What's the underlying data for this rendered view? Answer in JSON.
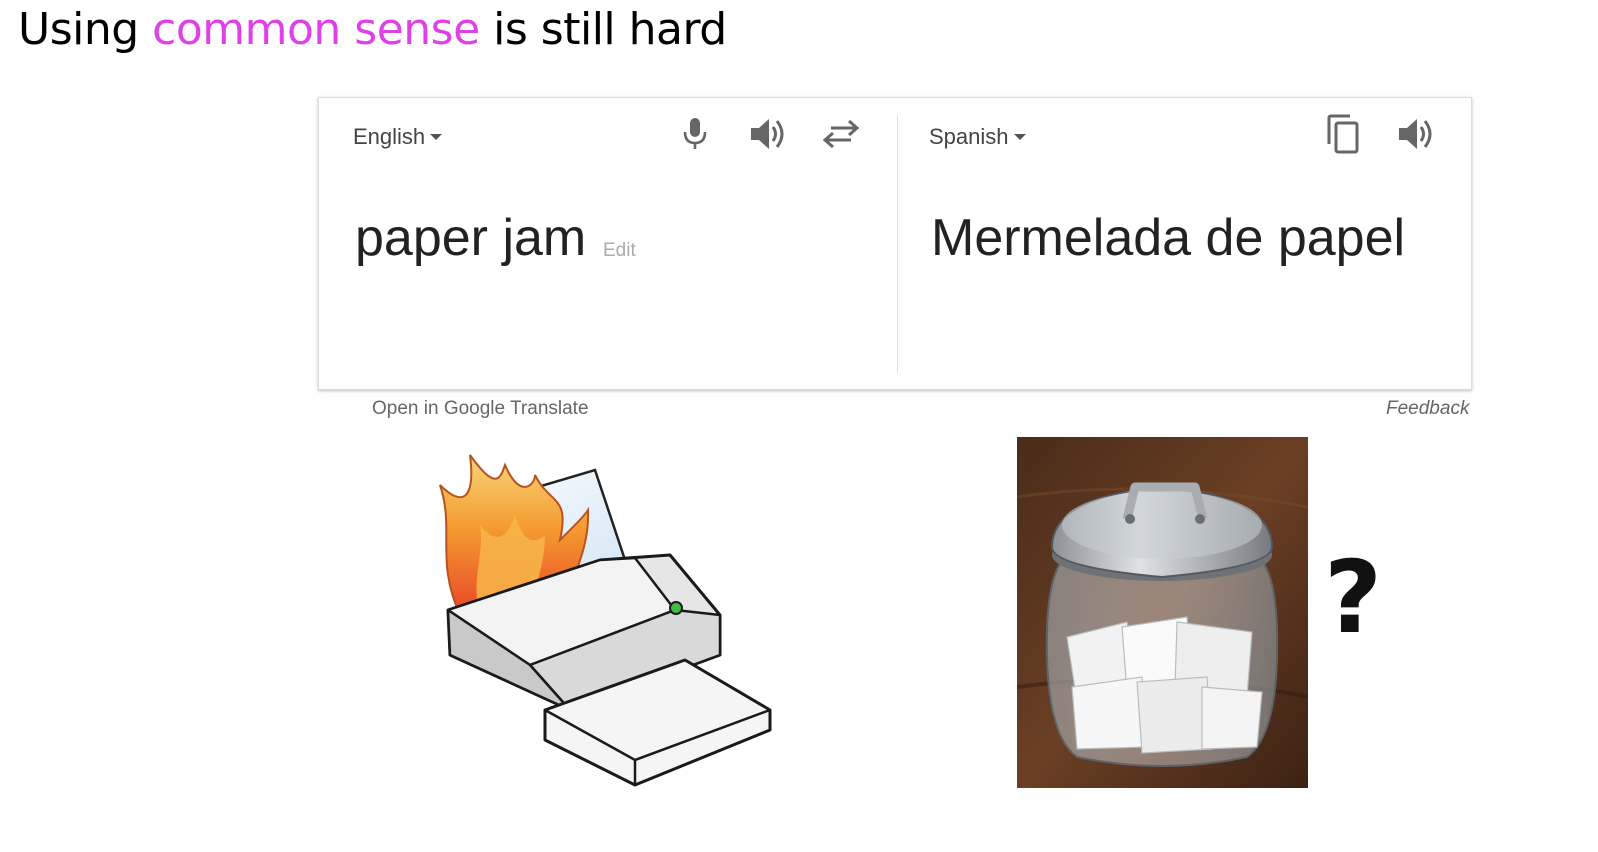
{
  "slide": {
    "title_before": "Using ",
    "title_highlight": "common sense",
    "title_after": " is still hard",
    "highlight_color": "#e040e8"
  },
  "translate_widget": {
    "source_language": "English",
    "target_language": "Spanish",
    "source_text": "paper jam",
    "edit_label": "Edit",
    "target_text": "Mermelada de papel",
    "source_icons": [
      "microphone-icon",
      "speaker-icon",
      "swap-icon"
    ],
    "target_icons": [
      "copy-icon",
      "speaker-icon"
    ],
    "open_link": "Open in Google Translate",
    "feedback_link": "Feedback"
  },
  "illustrations": {
    "left": "printer-on-fire-image",
    "right": "jar-of-paper-photo",
    "question_mark": "?"
  }
}
